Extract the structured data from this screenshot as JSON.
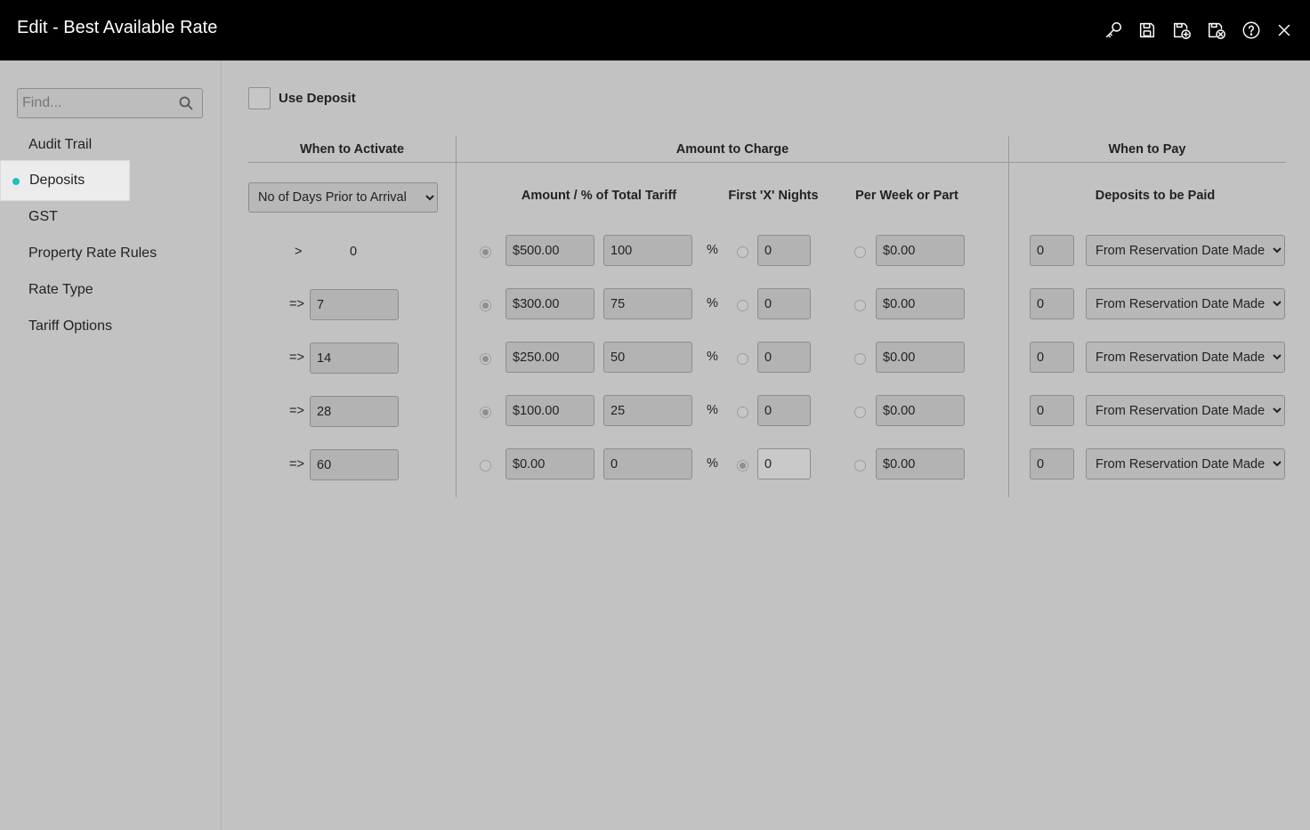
{
  "window": {
    "title": "Edit - Best Available Rate"
  },
  "toolbar_icons": [
    "key-icon",
    "save-icon",
    "save-new-icon",
    "save-close-icon",
    "help-icon",
    "close-icon"
  ],
  "sidebar": {
    "search_placeholder": "Find...",
    "items": [
      {
        "label": "Audit Trail",
        "active": false
      },
      {
        "label": "Deposits",
        "active": true
      },
      {
        "label": "GST",
        "active": false
      },
      {
        "label": "Property Rate Rules",
        "active": false
      },
      {
        "label": "Rate Type",
        "active": false
      },
      {
        "label": "Tariff Options",
        "active": false
      }
    ]
  },
  "deposits": {
    "use_deposit_label": "Use Deposit",
    "use_deposit_checked": false,
    "headers": {
      "when_to_activate": "When to Activate",
      "amount_to_charge": "Amount to Charge",
      "when_to_pay": "When to Pay"
    },
    "subheaders": {
      "amount_pct": "Amount / % of Total Tariff",
      "first_x_nights": "First 'X' Nights",
      "per_week": "Per Week or Part",
      "deposits_to_be_paid": "Deposits to be Paid"
    },
    "activation_mode": "No of Days Prior to Arrival",
    "percent_symbol": "%",
    "rows": [
      {
        "op": ">",
        "days": "0",
        "days_editable": false,
        "amount": "$500.00",
        "percent": "100",
        "nights": "0",
        "per_week": "$0.00",
        "pay_days": "0",
        "pay_from": "From Reservation Date Made",
        "selected": "amount"
      },
      {
        "op": "=>",
        "days": "7",
        "days_editable": true,
        "amount": "$300.00",
        "percent": "75",
        "nights": "0",
        "per_week": "$0.00",
        "pay_days": "0",
        "pay_from": "From Reservation Date Made",
        "selected": "amount"
      },
      {
        "op": "=>",
        "days": "14",
        "days_editable": true,
        "amount": "$250.00",
        "percent": "50",
        "nights": "0",
        "per_week": "$0.00",
        "pay_days": "0",
        "pay_from": "From Reservation Date Made",
        "selected": "amount"
      },
      {
        "op": "=>",
        "days": "28",
        "days_editable": true,
        "amount": "$100.00",
        "percent": "25",
        "nights": "0",
        "per_week": "$0.00",
        "pay_days": "0",
        "pay_from": "From Reservation Date Made",
        "selected": "amount"
      },
      {
        "op": "=>",
        "days": "60",
        "days_editable": true,
        "amount": "$0.00",
        "percent": "0",
        "nights": "0",
        "per_week": "$0.00",
        "pay_days": "0",
        "pay_from": "From Reservation Date Made",
        "selected": "nights"
      }
    ]
  },
  "colors": {
    "titlebar": "#000000",
    "background": "#c2c2c2",
    "active_dot": "#19c3c7"
  }
}
